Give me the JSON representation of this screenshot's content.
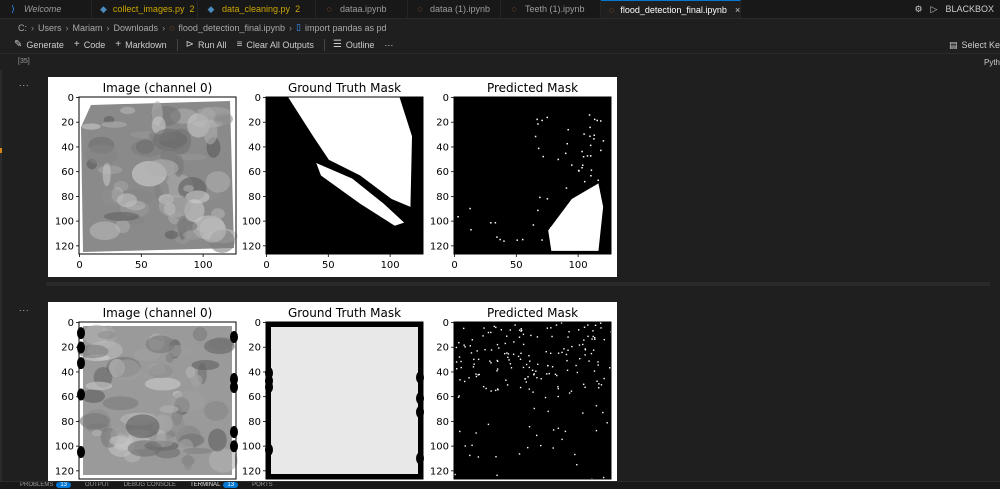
{
  "tabs": [
    {
      "label": "Welcome",
      "icon": "vscode-logo-icon",
      "kind": "welcome",
      "modified": ""
    },
    {
      "label": "collect_images.py",
      "icon": "python-file-icon",
      "kind": "py",
      "modified": "2"
    },
    {
      "label": "data_cleaning.py",
      "icon": "python-file-icon",
      "kind": "py",
      "modified": "2"
    },
    {
      "label": "dataa.ipynb",
      "icon": "notebook-file-icon",
      "kind": "nb",
      "modified": ""
    },
    {
      "label": "dataa (1).ipynb",
      "icon": "notebook-file-icon",
      "kind": "nb",
      "modified": ""
    },
    {
      "label": "Teeth (1).ipynb",
      "icon": "notebook-file-icon",
      "kind": "nb",
      "modified": ""
    },
    {
      "label": "flood_detection_final.ipynb",
      "icon": "notebook-file-icon",
      "kind": "active",
      "modified": ""
    }
  ],
  "tab_right": {
    "blackbox_label": "BLACKBOX"
  },
  "breadcrumb": {
    "drive": "C:",
    "users": "Users",
    "user": "Mariam",
    "folder": "Downloads",
    "file": "flood_detection_final.ipynb",
    "cell": "import pandas as pd"
  },
  "toolbar": {
    "generate": "Generate",
    "code": "Code",
    "markdown": "Markdown",
    "run_all": "Run All",
    "clear_outputs": "Clear All Outputs",
    "outline": "Outline",
    "more": "···",
    "select_kernel": "Select Ke"
  },
  "cell": {
    "execution_count": "[35]",
    "kernel": "Pyth",
    "output_menu": "..."
  },
  "colors": {
    "accent": "#0078d4",
    "modified": "#cca700",
    "background": "#1f1f1f"
  },
  "chart_data": [
    {
      "type": "heatmap",
      "panels": [
        {
          "title": "Image (channel 0)",
          "xticks": [
            "0",
            "50",
            "100"
          ],
          "yticks": [
            "0",
            "20",
            "40",
            "60",
            "80",
            "100",
            "120"
          ],
          "xlim": [
            0,
            127
          ],
          "ylim": [
            127,
            0
          ]
        },
        {
          "title": "Ground Truth Mask",
          "xticks": [
            "0",
            "50",
            "100"
          ],
          "yticks": [
            "0",
            "20",
            "40",
            "60",
            "80",
            "100",
            "120"
          ],
          "xlim": [
            0,
            127
          ],
          "ylim": [
            127,
            0
          ]
        },
        {
          "title": "Predicted Mask",
          "xticks": [
            "0",
            "50",
            "100"
          ],
          "yticks": [
            "0",
            "20",
            "40",
            "60",
            "80",
            "100",
            "120"
          ],
          "xlim": [
            0,
            127
          ],
          "ylim": [
            127,
            0
          ]
        }
      ]
    },
    {
      "type": "heatmap",
      "panels": [
        {
          "title": "Image (channel 0)",
          "xticks": [],
          "yticks": [
            "0",
            "20",
            "40",
            "60",
            "80",
            "100",
            "120"
          ],
          "xlim": [
            0,
            127
          ],
          "ylim": [
            127,
            0
          ]
        },
        {
          "title": "Ground Truth Mask",
          "xticks": [],
          "yticks": [
            "0",
            "20",
            "40",
            "60",
            "80",
            "100",
            "120"
          ],
          "xlim": [
            0,
            127
          ],
          "ylim": [
            127,
            0
          ]
        },
        {
          "title": "Predicted Mask",
          "xticks": [],
          "yticks": [
            "0",
            "20",
            "40",
            "60",
            "80",
            "100",
            "120"
          ],
          "xlim": [
            0,
            127
          ],
          "ylim": [
            127,
            0
          ]
        }
      ]
    }
  ],
  "panel": {
    "tabs": [
      {
        "label": "PROBLEMS",
        "badge": "13"
      },
      {
        "label": "OUTPUT",
        "badge": ""
      },
      {
        "label": "DEBUG CONSOLE",
        "badge": ""
      },
      {
        "label": "TERMINAL",
        "badge": "13"
      },
      {
        "label": "PORTS",
        "badge": ""
      }
    ]
  }
}
